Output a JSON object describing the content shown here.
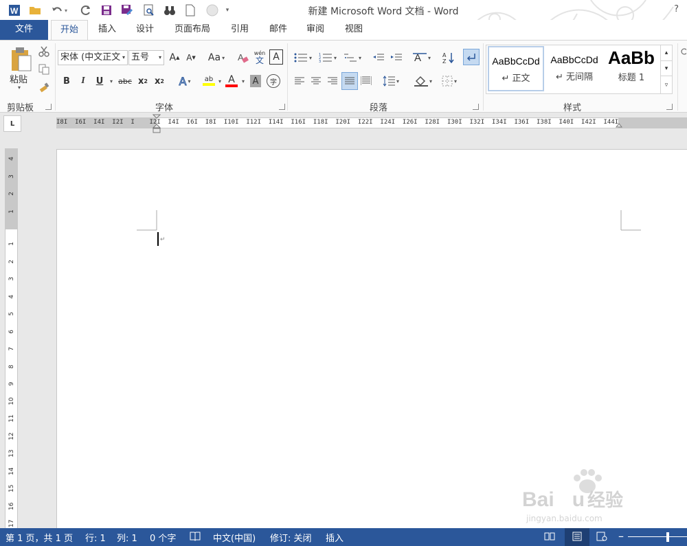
{
  "app": {
    "title": "新建 Microsoft Word 文档 - Word",
    "help": "?"
  },
  "quick_access": [
    {
      "icon": "word-logo-icon"
    },
    {
      "icon": "open-folder-icon"
    },
    {
      "icon": "undo-icon"
    },
    {
      "icon": "redo-icon"
    },
    {
      "icon": "save-icon"
    },
    {
      "icon": "save-as-icon"
    },
    {
      "icon": "print-preview-icon"
    },
    {
      "icon": "find-binoculars-icon"
    },
    {
      "icon": "new-document-icon"
    },
    {
      "icon": "circle-icon"
    },
    {
      "icon": "customize-qat-icon"
    }
  ],
  "tabs": {
    "file": "文件",
    "home": "开始",
    "insert": "插入",
    "design": "设计",
    "layout": "页面布局",
    "references": "引用",
    "mailings": "邮件",
    "review": "审阅",
    "view": "视图"
  },
  "ribbon": {
    "clipboard": {
      "label": "剪贴板",
      "paste": "粘贴"
    },
    "font": {
      "label": "字体",
      "font_name": "宋体 (中文正文",
      "font_size": "五号",
      "grow": "A",
      "shrink": "A",
      "change_case": "Aa",
      "phonetic_top": "wén",
      "phonetic_bottom": "文",
      "border_char": "A",
      "bold": "B",
      "italic": "I",
      "underline": "U",
      "strike": "abc",
      "subscript": "x",
      "superscript": "x",
      "sub_mark": "2",
      "sup_mark": "2",
      "text_effects": "A",
      "highlight": "ab",
      "font_color": "A",
      "char_shading": "A",
      "enclose": "字"
    },
    "paragraph": {
      "label": "段落"
    },
    "styles": {
      "label": "样式",
      "items": [
        {
          "sample": "AaBbCcDd",
          "name": "↵ 正文"
        },
        {
          "sample": "AaBbCcDd",
          "name": "↵ 无间隔"
        },
        {
          "sample": "AaBb",
          "name": "标题 1"
        }
      ]
    }
  },
  "ruler": {
    "tab_selector": "L",
    "numbers": "I8I  I6I  I4I  I2I  I    I2I  I4I  I6I  I8I  I10I  I12I  I14I  I16I  I18I  I20I  I22I  I24I  I26I  I28I  I30I  I32I  I34I  I36I  I38I  I40I  I42I  I44I",
    "vertical_numbers": [
      "4",
      "3",
      "2",
      "1",
      "1",
      "2",
      "3",
      "4",
      "5",
      "6",
      "7",
      "8",
      "9",
      "10",
      "11",
      "12",
      "13",
      "14",
      "15",
      "16",
      "17"
    ]
  },
  "status": {
    "page": "第 1 页，共 1 页",
    "line": "行: 1",
    "column": "列: 1",
    "words": "0 个字",
    "language": "中文(中国)",
    "track_changes": "修订: 关闭",
    "mode": "插入"
  },
  "watermark": {
    "brand": "Bai",
    "brand_tail": "u",
    "cn": "经验",
    "url": "jingyan.baidu.com"
  },
  "colors": {
    "accent": "#2b579a",
    "highlight": "#ffff00",
    "font_color": "#ff0000"
  }
}
